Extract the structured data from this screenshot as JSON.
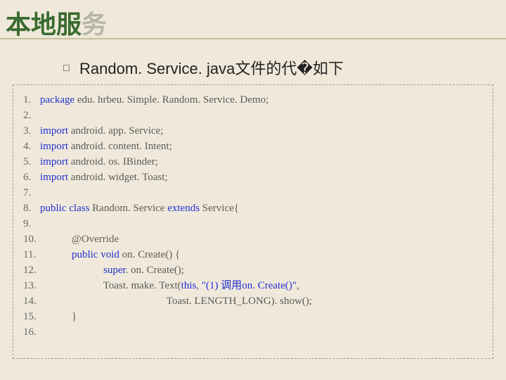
{
  "title_green": "本地服",
  "title_grey": "务",
  "subtitle": "Random. Service. java文件的代�如下",
  "code": {
    "lines": [
      {
        "n": "1.",
        "segs": [
          {
            "t": "package ",
            "c": "kw"
          },
          {
            "t": "edu. hrbeu. Simple. Random. Service. Demo;",
            "c": ""
          }
        ]
      },
      {
        "n": "2.",
        "segs": [
          {
            "t": "",
            "c": ""
          }
        ]
      },
      {
        "n": "3.",
        "segs": [
          {
            "t": "import ",
            "c": "kw"
          },
          {
            "t": "android. app. Service;",
            "c": ""
          }
        ]
      },
      {
        "n": "4.",
        "segs": [
          {
            "t": "import ",
            "c": "kw"
          },
          {
            "t": "android. content. Intent;",
            "c": ""
          }
        ]
      },
      {
        "n": "5.",
        "segs": [
          {
            "t": "import ",
            "c": "kw"
          },
          {
            "t": "android. os. IBinder;",
            "c": ""
          }
        ]
      },
      {
        "n": "6.",
        "segs": [
          {
            "t": "import ",
            "c": "kw"
          },
          {
            "t": "android. widget. Toast;",
            "c": ""
          }
        ]
      },
      {
        "n": "7.",
        "segs": [
          {
            "t": "",
            "c": ""
          }
        ]
      },
      {
        "n": "8.",
        "segs": [
          {
            "t": "public class ",
            "c": "kw"
          },
          {
            "t": "Random. Service ",
            "c": ""
          },
          {
            "t": "extends ",
            "c": "kw"
          },
          {
            "t": "Service{",
            "c": ""
          }
        ]
      },
      {
        "n": "9.",
        "segs": [
          {
            "t": "",
            "c": ""
          }
        ]
      },
      {
        "n": "10.",
        "segs": [
          {
            "t": "            @Override",
            "c": "ovr"
          }
        ]
      },
      {
        "n": "11.",
        "segs": [
          {
            "t": "            ",
            "c": ""
          },
          {
            "t": "public void ",
            "c": "kw"
          },
          {
            "t": "on. Create() {",
            "c": ""
          }
        ]
      },
      {
        "n": "12.",
        "segs": [
          {
            "t": "                        ",
            "c": ""
          },
          {
            "t": "super",
            "c": "kw"
          },
          {
            "t": ". on. Create();",
            "c": ""
          }
        ]
      },
      {
        "n": "13.",
        "segs": [
          {
            "t": "                        Toast. make. Text(",
            "c": ""
          },
          {
            "t": "this",
            "c": "kw"
          },
          {
            "t": ", ",
            "c": ""
          },
          {
            "t": "\"(1) 调用on. Create()\"",
            "c": "str"
          },
          {
            "t": ",",
            "c": ""
          }
        ]
      },
      {
        "n": "14.",
        "segs": [
          {
            "t": "                                                Toast. LENGTH_LONG). show();",
            "c": ""
          }
        ]
      },
      {
        "n": "15.",
        "segs": [
          {
            "t": "            }",
            "c": ""
          }
        ]
      },
      {
        "n": "16.",
        "segs": [
          {
            "t": "",
            "c": ""
          }
        ]
      }
    ]
  }
}
